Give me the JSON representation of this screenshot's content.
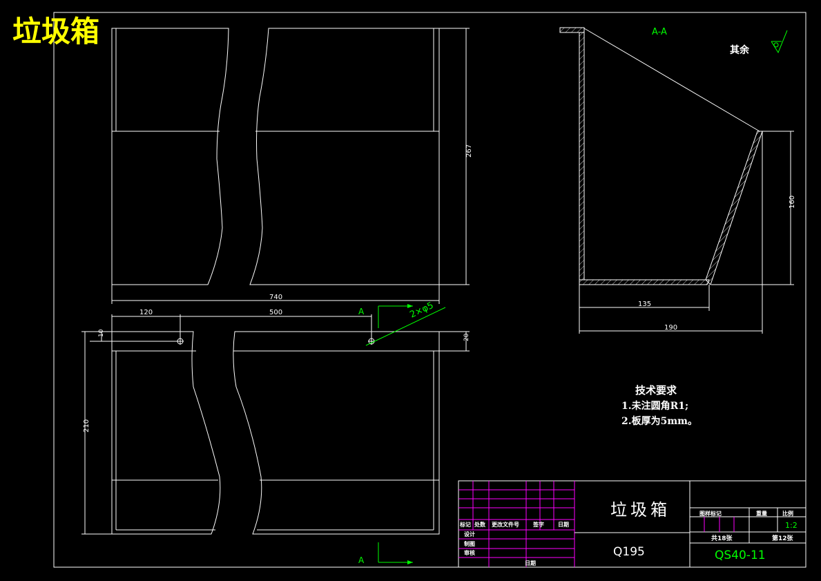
{
  "title": "垃圾箱",
  "section_label": "A-A",
  "section_marker": "A",
  "hole_note": "2×φ5",
  "surface_note": "其余",
  "dimensions": {
    "top_height": "267",
    "top_width": "740",
    "bottom_left_offset": "120",
    "hole_spacing": "500",
    "flange_10": "10",
    "flange_20": "20",
    "bottom_height": "210",
    "section_height": "160",
    "section_base": "135",
    "section_total": "190"
  },
  "tech_requirements": {
    "heading": "技术要求",
    "items": [
      "1.未注圆角R1;",
      "2.板厚为5mm。"
    ]
  },
  "title_block": {
    "part_name": "垃圾箱",
    "material": "Q195",
    "drawing_no": "QS40-11",
    "scale": "1:2",
    "weight_label": "重量",
    "scale_label": "比例",
    "stage_label": "图样标记",
    "sheet_total": "共18张",
    "sheet_no": "第12张",
    "rev_headers": [
      "标记",
      "处数",
      "更改文件号",
      "签字",
      "日期"
    ],
    "roles": [
      "设计",
      "制图",
      "审核"
    ],
    "date_label": "日期"
  }
}
